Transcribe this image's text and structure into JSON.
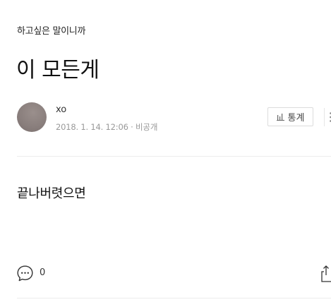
{
  "post": {
    "category": "하고싶은 말이니까",
    "title": "이 모든게",
    "author": "xo",
    "meta": "2018. 1. 14. 12:06 · 비공개",
    "body": "끝나버렷으면"
  },
  "toolbar": {
    "stats_label": "통계",
    "stats_icon": "bar-chart-icon",
    "more_icon": "more-vertical-icon"
  },
  "footer": {
    "comment_icon": "comment-bubble-icon",
    "comment_count": "0",
    "share_icon": "share-icon"
  },
  "colors": {
    "text": "#111111",
    "meta": "#999999",
    "border": "#dcdcdc"
  }
}
